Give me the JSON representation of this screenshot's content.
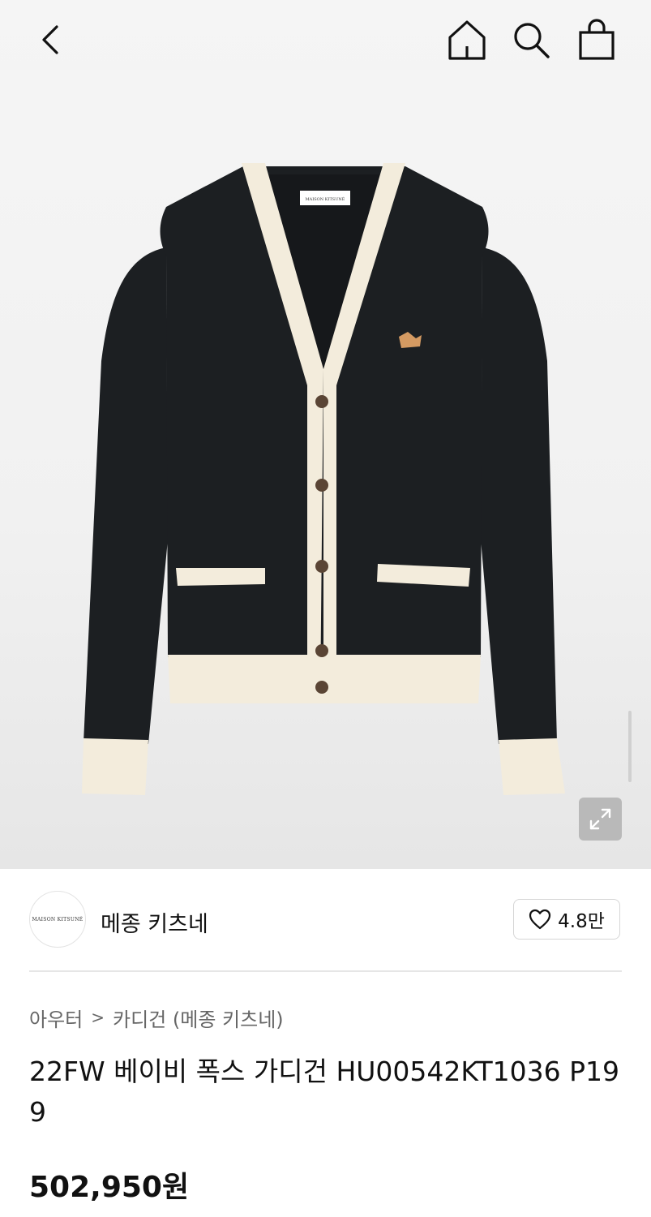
{
  "header": {
    "back_icon": "chevron-left-icon",
    "home_icon": "home-icon",
    "search_icon": "search-icon",
    "bag_icon": "shopping-bag-icon"
  },
  "product_image": {
    "label_text": "MAISON KITSUNÉ"
  },
  "expand_icon": "expand-icon",
  "brand": {
    "logo_text": "MAISON KITSUNÉ",
    "name": "메종 키츠네",
    "like_icon": "heart-icon",
    "like_count": "4.8만"
  },
  "breadcrumb": {
    "items": [
      "아우터",
      "카디건 (메종 키츠네)"
    ],
    "separator": ">"
  },
  "product": {
    "title": "22FW 베이비 폭스 가디건 HU00542KT1036 P199",
    "price": "502,950원"
  },
  "colors": {
    "body": "#1c1f22",
    "trim": "#f3ecdc",
    "button": "#5a4535"
  }
}
